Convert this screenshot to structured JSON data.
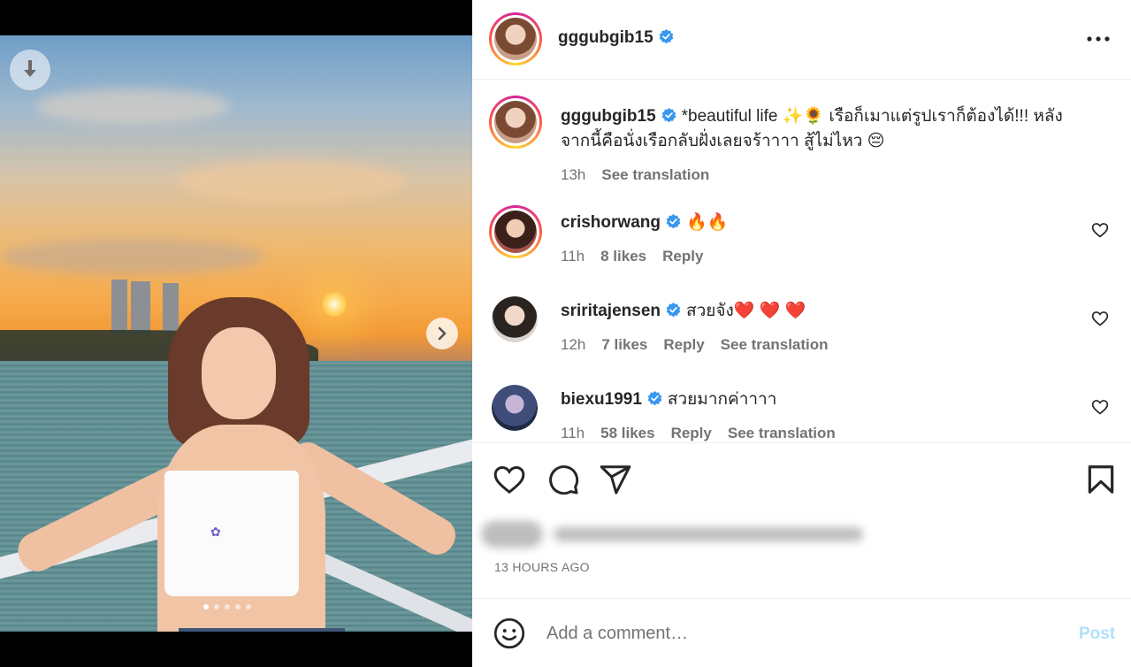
{
  "post": {
    "author": "gggubgib15",
    "verified": true,
    "image_dots": 5,
    "active_dot": 0
  },
  "caption": {
    "username": "gggubgib15",
    "text": "*beautiful life ✨🌻 เรือก็เมาแต่รูปเราก็ต้องได้!!! หลังจากนี้คือนั่งเรือกลับฝั่งเลยจร้าาาา สู้ไม่ไหว 😔",
    "time": "13h",
    "see_translation": "See translation"
  },
  "comments": [
    {
      "username": "crishorwang",
      "text": "🔥🔥",
      "time": "11h",
      "likes": "8 likes",
      "reply": "Reply",
      "see_translation": ""
    },
    {
      "username": "sriritajensen",
      "text": "สวยจัง❤️ ❤️ ❤️",
      "time": "12h",
      "likes": "7 likes",
      "reply": "Reply",
      "see_translation": "See translation"
    },
    {
      "username": "biexu1991",
      "text": "สวยมากค่าาาา",
      "time": "11h",
      "likes": "58 likes",
      "reply": "Reply",
      "see_translation": "See translation"
    }
  ],
  "timestamp": "13 HOURS AGO",
  "add_comment": {
    "placeholder": "Add a comment…",
    "post_label": "Post"
  },
  "colors": {
    "verified": "#3897f0",
    "post_button_disabled": "#b2dffc",
    "meta": "#737373"
  }
}
